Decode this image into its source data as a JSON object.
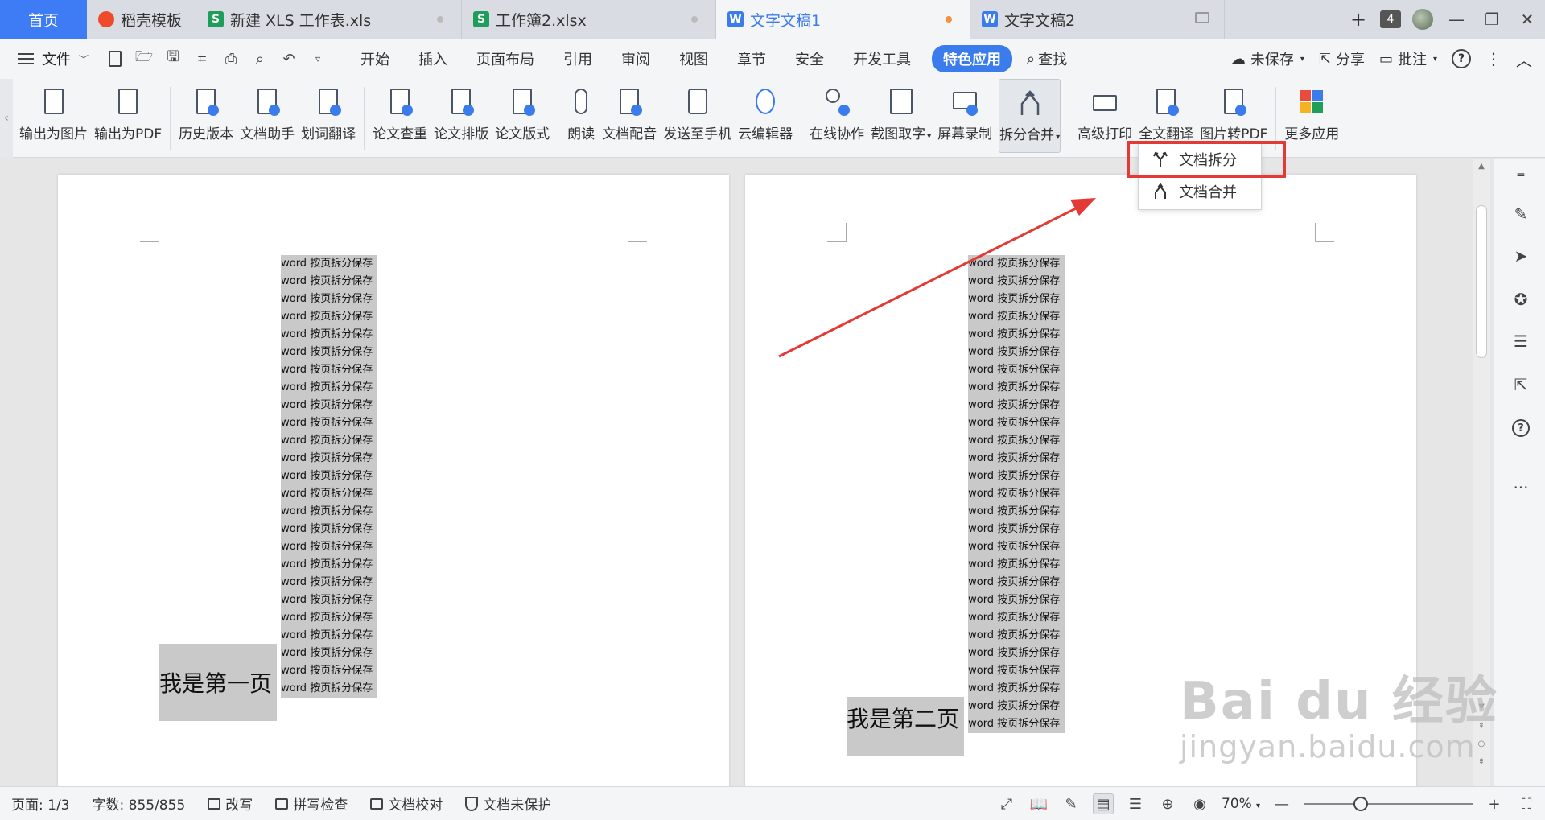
{
  "tabs": [
    {
      "label": "首页",
      "type": "home"
    },
    {
      "label": "稻壳模板",
      "type": "daoke"
    },
    {
      "label": "新建 XLS 工作表.xls",
      "type": "xls"
    },
    {
      "label": "工作簿2.xlsx",
      "type": "xls"
    },
    {
      "label": "文字文稿1",
      "type": "doc",
      "active": true
    },
    {
      "label": "文字文稿2",
      "type": "doc"
    }
  ],
  "tab_icons": {
    "xls": "S",
    "doc": "W"
  },
  "window_count": "4",
  "menu": {
    "file": "文件",
    "items": [
      "开始",
      "插入",
      "页面布局",
      "引用",
      "审阅",
      "视图",
      "章节",
      "安全",
      "开发工具",
      "特色应用"
    ],
    "active": "特色应用",
    "search": "查找",
    "right": {
      "unsaved": "未保存",
      "share": "分享",
      "annotate": "批注"
    }
  },
  "ribbon": {
    "groups": [
      [
        "输出为图片",
        "输出为PDF"
      ],
      [
        "历史版本",
        "文档助手",
        "划词翻译"
      ],
      [
        "论文查重",
        "论文排版",
        "论文版式"
      ],
      [
        "朗读",
        "文档配音",
        "发送至手机",
        "云编辑器"
      ],
      [
        "在线协作",
        "截图取字",
        "屏幕录制",
        "拆分合并"
      ],
      [
        "高级打印",
        "全文翻译",
        "图片转PDF"
      ],
      [
        "更多应用"
      ]
    ],
    "pressed": "拆分合并",
    "with_caret": [
      "截图取字",
      "拆分合并"
    ]
  },
  "dropdown": {
    "items": [
      {
        "label": "文档拆分",
        "icon": "split-icon"
      },
      {
        "label": "文档合并",
        "icon": "merge-icon"
      }
    ]
  },
  "pages": [
    {
      "heading": "我是第一页",
      "line_text": "word 按页拆分保存",
      "line_count": 25
    },
    {
      "heading": "我是第二页",
      "line_text": "word 按页拆分保存",
      "line_count": 27
    }
  ],
  "status": {
    "page": "页面: 1/3",
    "words": "字数: 855/855",
    "revise": "改写",
    "spell": "拼写检查",
    "proof": "文档校对",
    "protect": "文档未保护",
    "zoom": "70%"
  },
  "watermark": {
    "line1": "Bai du 经验",
    "line2": "jingyan.baidu.com"
  },
  "colors": {
    "accent": "#3b7ced",
    "highlight": "#e53935",
    "arrow": "#e53935",
    "xls": "#1e9e58"
  }
}
